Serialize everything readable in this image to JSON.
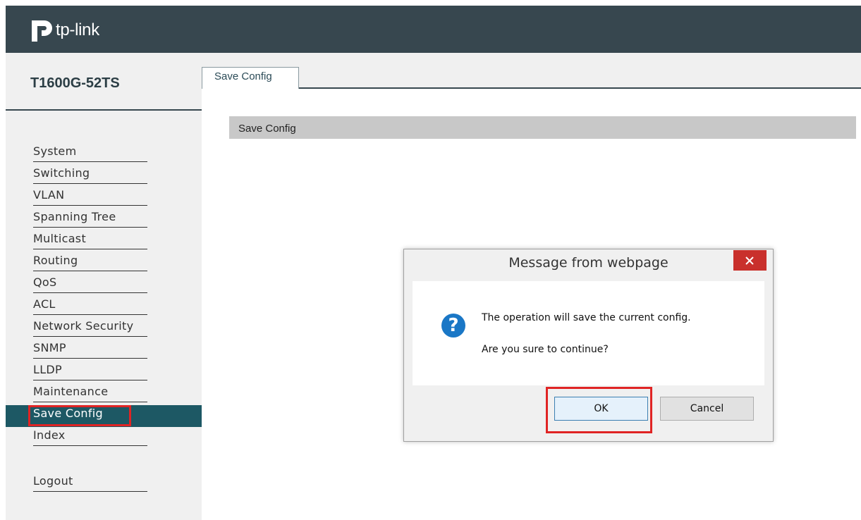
{
  "header": {
    "logo_text": "tp-link",
    "logo_icon": "tp-link-logo-icon",
    "bg_color": "#37474f"
  },
  "sidebar": {
    "model": "T1600G-52TS",
    "items": [
      {
        "label": "System"
      },
      {
        "label": "Switching"
      },
      {
        "label": "VLAN"
      },
      {
        "label": "Spanning Tree"
      },
      {
        "label": "Multicast"
      },
      {
        "label": "Routing"
      },
      {
        "label": "QoS"
      },
      {
        "label": "ACL"
      },
      {
        "label": "Network Security"
      },
      {
        "label": "SNMP"
      },
      {
        "label": "LLDP"
      },
      {
        "label": "Maintenance"
      },
      {
        "label": "Save Config",
        "active": true
      },
      {
        "label": "Index"
      }
    ],
    "logout": "Logout",
    "active_color": "#1d5864"
  },
  "tabs": [
    {
      "label": "Save Config",
      "active": true
    }
  ],
  "section": {
    "title": "Save Config"
  },
  "dialog": {
    "title": "Message from webpage",
    "close_icon": "close-icon",
    "icon": "question-icon",
    "message_line1": "The operation will save the current config.",
    "message_line2": "Are you sure to continue?",
    "ok_label": "OK",
    "cancel_label": "Cancel"
  },
  "highlight_color": "#e02424"
}
